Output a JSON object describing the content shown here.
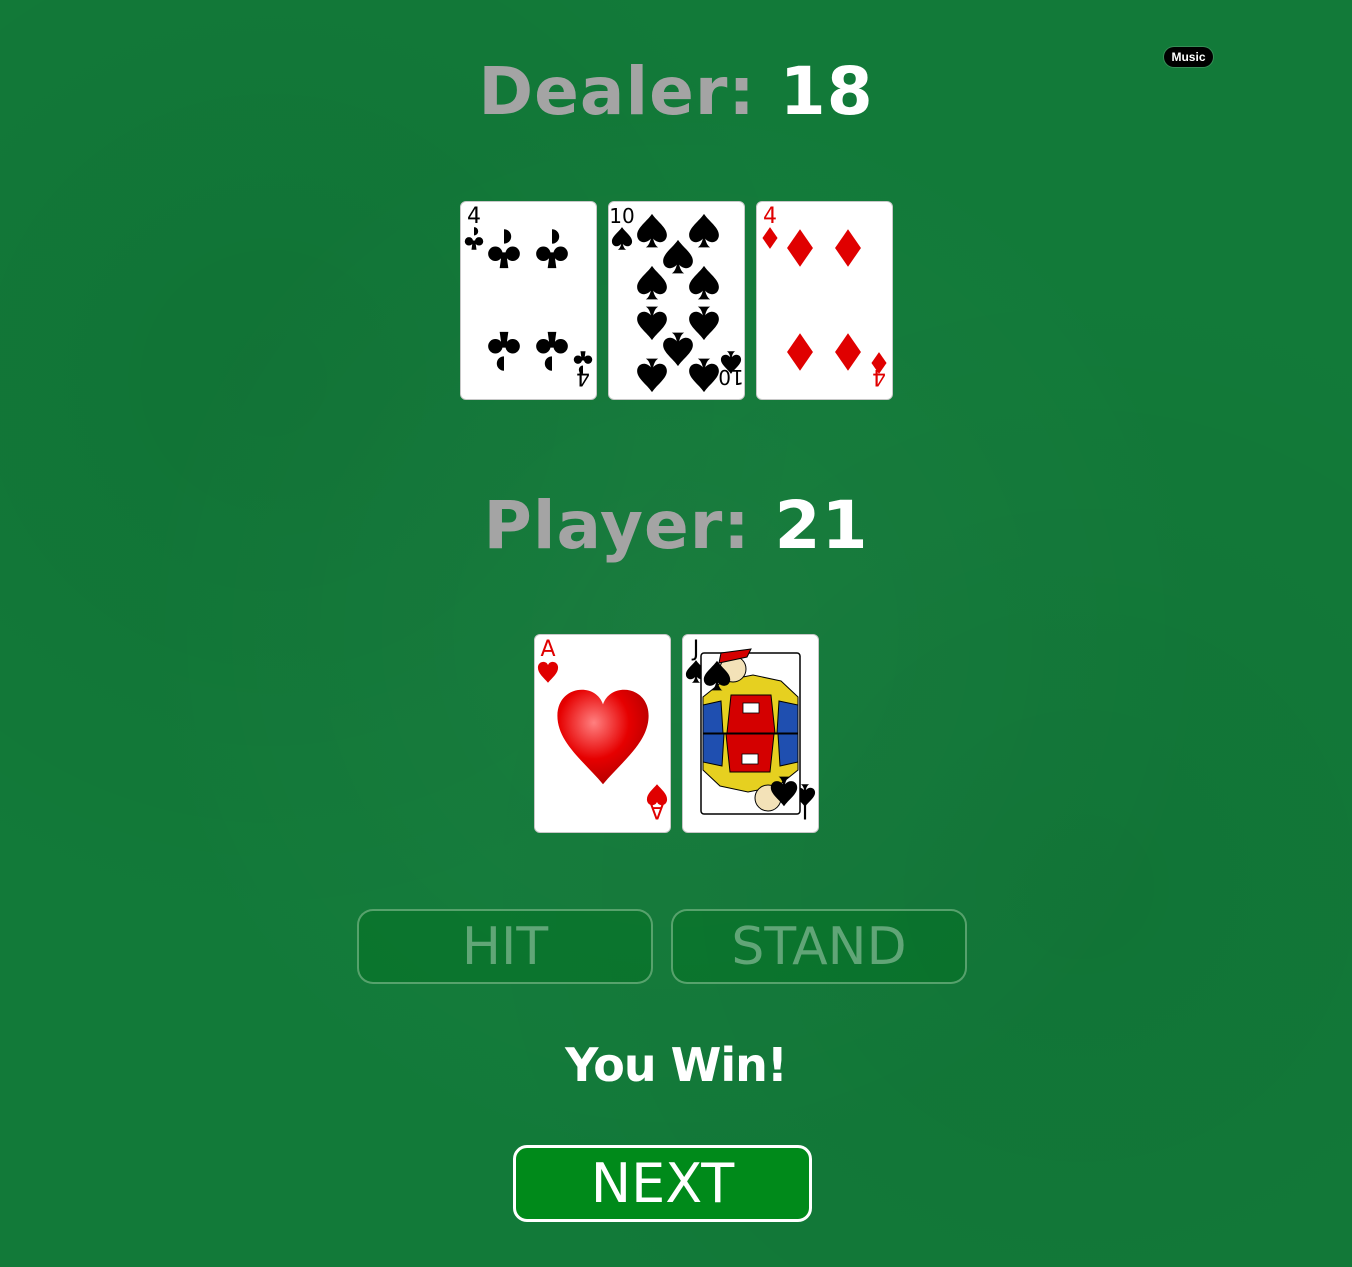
{
  "header": {
    "music_label": "Music"
  },
  "dealer": {
    "label": "Dealer: ",
    "score": "18",
    "cards": [
      {
        "rank": "4",
        "suit": "clubs",
        "color": "#000000"
      },
      {
        "rank": "10",
        "suit": "spades",
        "color": "#000000"
      },
      {
        "rank": "4",
        "suit": "diamonds",
        "color": "#e00000"
      }
    ]
  },
  "player": {
    "label": "Player: ",
    "score": "21",
    "cards": [
      {
        "rank": "A",
        "suit": "hearts",
        "color": "#e00000"
      },
      {
        "rank": "J",
        "suit": "spades",
        "color": "#000000"
      }
    ]
  },
  "controls": {
    "hit_label": "HIT",
    "stand_label": "STAND",
    "next_label": "NEXT"
  },
  "result": {
    "message": "You Win!"
  },
  "colors": {
    "felt": "#127a39",
    "score_label": "#a4a4a4",
    "next_button": "#008a1a",
    "red_suit": "#e00000"
  }
}
